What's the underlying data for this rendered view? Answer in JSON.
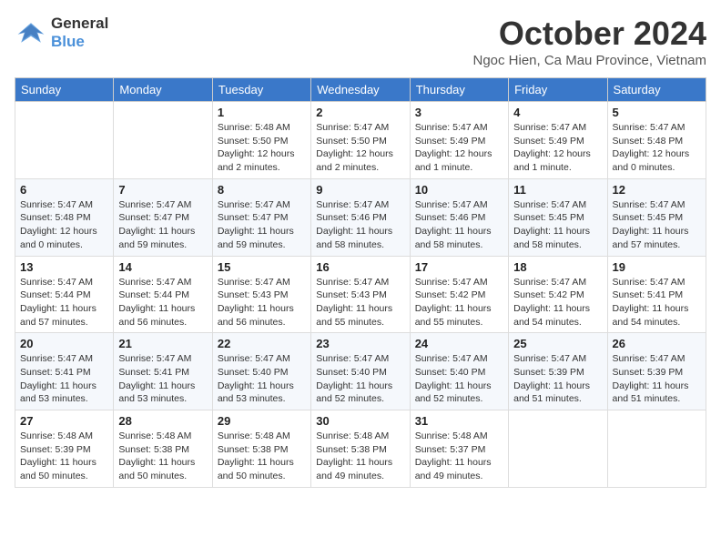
{
  "logo": {
    "line1": "General",
    "line2": "Blue"
  },
  "title": "October 2024",
  "subtitle": "Ngoc Hien, Ca Mau Province, Vietnam",
  "days_of_week": [
    "Sunday",
    "Monday",
    "Tuesday",
    "Wednesday",
    "Thursday",
    "Friday",
    "Saturday"
  ],
  "weeks": [
    [
      {
        "day": "",
        "info": ""
      },
      {
        "day": "",
        "info": ""
      },
      {
        "day": "1",
        "info": "Sunrise: 5:48 AM\nSunset: 5:50 PM\nDaylight: 12 hours and 2 minutes."
      },
      {
        "day": "2",
        "info": "Sunrise: 5:47 AM\nSunset: 5:50 PM\nDaylight: 12 hours and 2 minutes."
      },
      {
        "day": "3",
        "info": "Sunrise: 5:47 AM\nSunset: 5:49 PM\nDaylight: 12 hours and 1 minute."
      },
      {
        "day": "4",
        "info": "Sunrise: 5:47 AM\nSunset: 5:49 PM\nDaylight: 12 hours and 1 minute."
      },
      {
        "day": "5",
        "info": "Sunrise: 5:47 AM\nSunset: 5:48 PM\nDaylight: 12 hours and 0 minutes."
      }
    ],
    [
      {
        "day": "6",
        "info": "Sunrise: 5:47 AM\nSunset: 5:48 PM\nDaylight: 12 hours and 0 minutes."
      },
      {
        "day": "7",
        "info": "Sunrise: 5:47 AM\nSunset: 5:47 PM\nDaylight: 11 hours and 59 minutes."
      },
      {
        "day": "8",
        "info": "Sunrise: 5:47 AM\nSunset: 5:47 PM\nDaylight: 11 hours and 59 minutes."
      },
      {
        "day": "9",
        "info": "Sunrise: 5:47 AM\nSunset: 5:46 PM\nDaylight: 11 hours and 58 minutes."
      },
      {
        "day": "10",
        "info": "Sunrise: 5:47 AM\nSunset: 5:46 PM\nDaylight: 11 hours and 58 minutes."
      },
      {
        "day": "11",
        "info": "Sunrise: 5:47 AM\nSunset: 5:45 PM\nDaylight: 11 hours and 58 minutes."
      },
      {
        "day": "12",
        "info": "Sunrise: 5:47 AM\nSunset: 5:45 PM\nDaylight: 11 hours and 57 minutes."
      }
    ],
    [
      {
        "day": "13",
        "info": "Sunrise: 5:47 AM\nSunset: 5:44 PM\nDaylight: 11 hours and 57 minutes."
      },
      {
        "day": "14",
        "info": "Sunrise: 5:47 AM\nSunset: 5:44 PM\nDaylight: 11 hours and 56 minutes."
      },
      {
        "day": "15",
        "info": "Sunrise: 5:47 AM\nSunset: 5:43 PM\nDaylight: 11 hours and 56 minutes."
      },
      {
        "day": "16",
        "info": "Sunrise: 5:47 AM\nSunset: 5:43 PM\nDaylight: 11 hours and 55 minutes."
      },
      {
        "day": "17",
        "info": "Sunrise: 5:47 AM\nSunset: 5:42 PM\nDaylight: 11 hours and 55 minutes."
      },
      {
        "day": "18",
        "info": "Sunrise: 5:47 AM\nSunset: 5:42 PM\nDaylight: 11 hours and 54 minutes."
      },
      {
        "day": "19",
        "info": "Sunrise: 5:47 AM\nSunset: 5:41 PM\nDaylight: 11 hours and 54 minutes."
      }
    ],
    [
      {
        "day": "20",
        "info": "Sunrise: 5:47 AM\nSunset: 5:41 PM\nDaylight: 11 hours and 53 minutes."
      },
      {
        "day": "21",
        "info": "Sunrise: 5:47 AM\nSunset: 5:41 PM\nDaylight: 11 hours and 53 minutes."
      },
      {
        "day": "22",
        "info": "Sunrise: 5:47 AM\nSunset: 5:40 PM\nDaylight: 11 hours and 53 minutes."
      },
      {
        "day": "23",
        "info": "Sunrise: 5:47 AM\nSunset: 5:40 PM\nDaylight: 11 hours and 52 minutes."
      },
      {
        "day": "24",
        "info": "Sunrise: 5:47 AM\nSunset: 5:40 PM\nDaylight: 11 hours and 52 minutes."
      },
      {
        "day": "25",
        "info": "Sunrise: 5:47 AM\nSunset: 5:39 PM\nDaylight: 11 hours and 51 minutes."
      },
      {
        "day": "26",
        "info": "Sunrise: 5:47 AM\nSunset: 5:39 PM\nDaylight: 11 hours and 51 minutes."
      }
    ],
    [
      {
        "day": "27",
        "info": "Sunrise: 5:48 AM\nSunset: 5:39 PM\nDaylight: 11 hours and 50 minutes."
      },
      {
        "day": "28",
        "info": "Sunrise: 5:48 AM\nSunset: 5:38 PM\nDaylight: 11 hours and 50 minutes."
      },
      {
        "day": "29",
        "info": "Sunrise: 5:48 AM\nSunset: 5:38 PM\nDaylight: 11 hours and 50 minutes."
      },
      {
        "day": "30",
        "info": "Sunrise: 5:48 AM\nSunset: 5:38 PM\nDaylight: 11 hours and 49 minutes."
      },
      {
        "day": "31",
        "info": "Sunrise: 5:48 AM\nSunset: 5:37 PM\nDaylight: 11 hours and 49 minutes."
      },
      {
        "day": "",
        "info": ""
      },
      {
        "day": "",
        "info": ""
      }
    ]
  ]
}
